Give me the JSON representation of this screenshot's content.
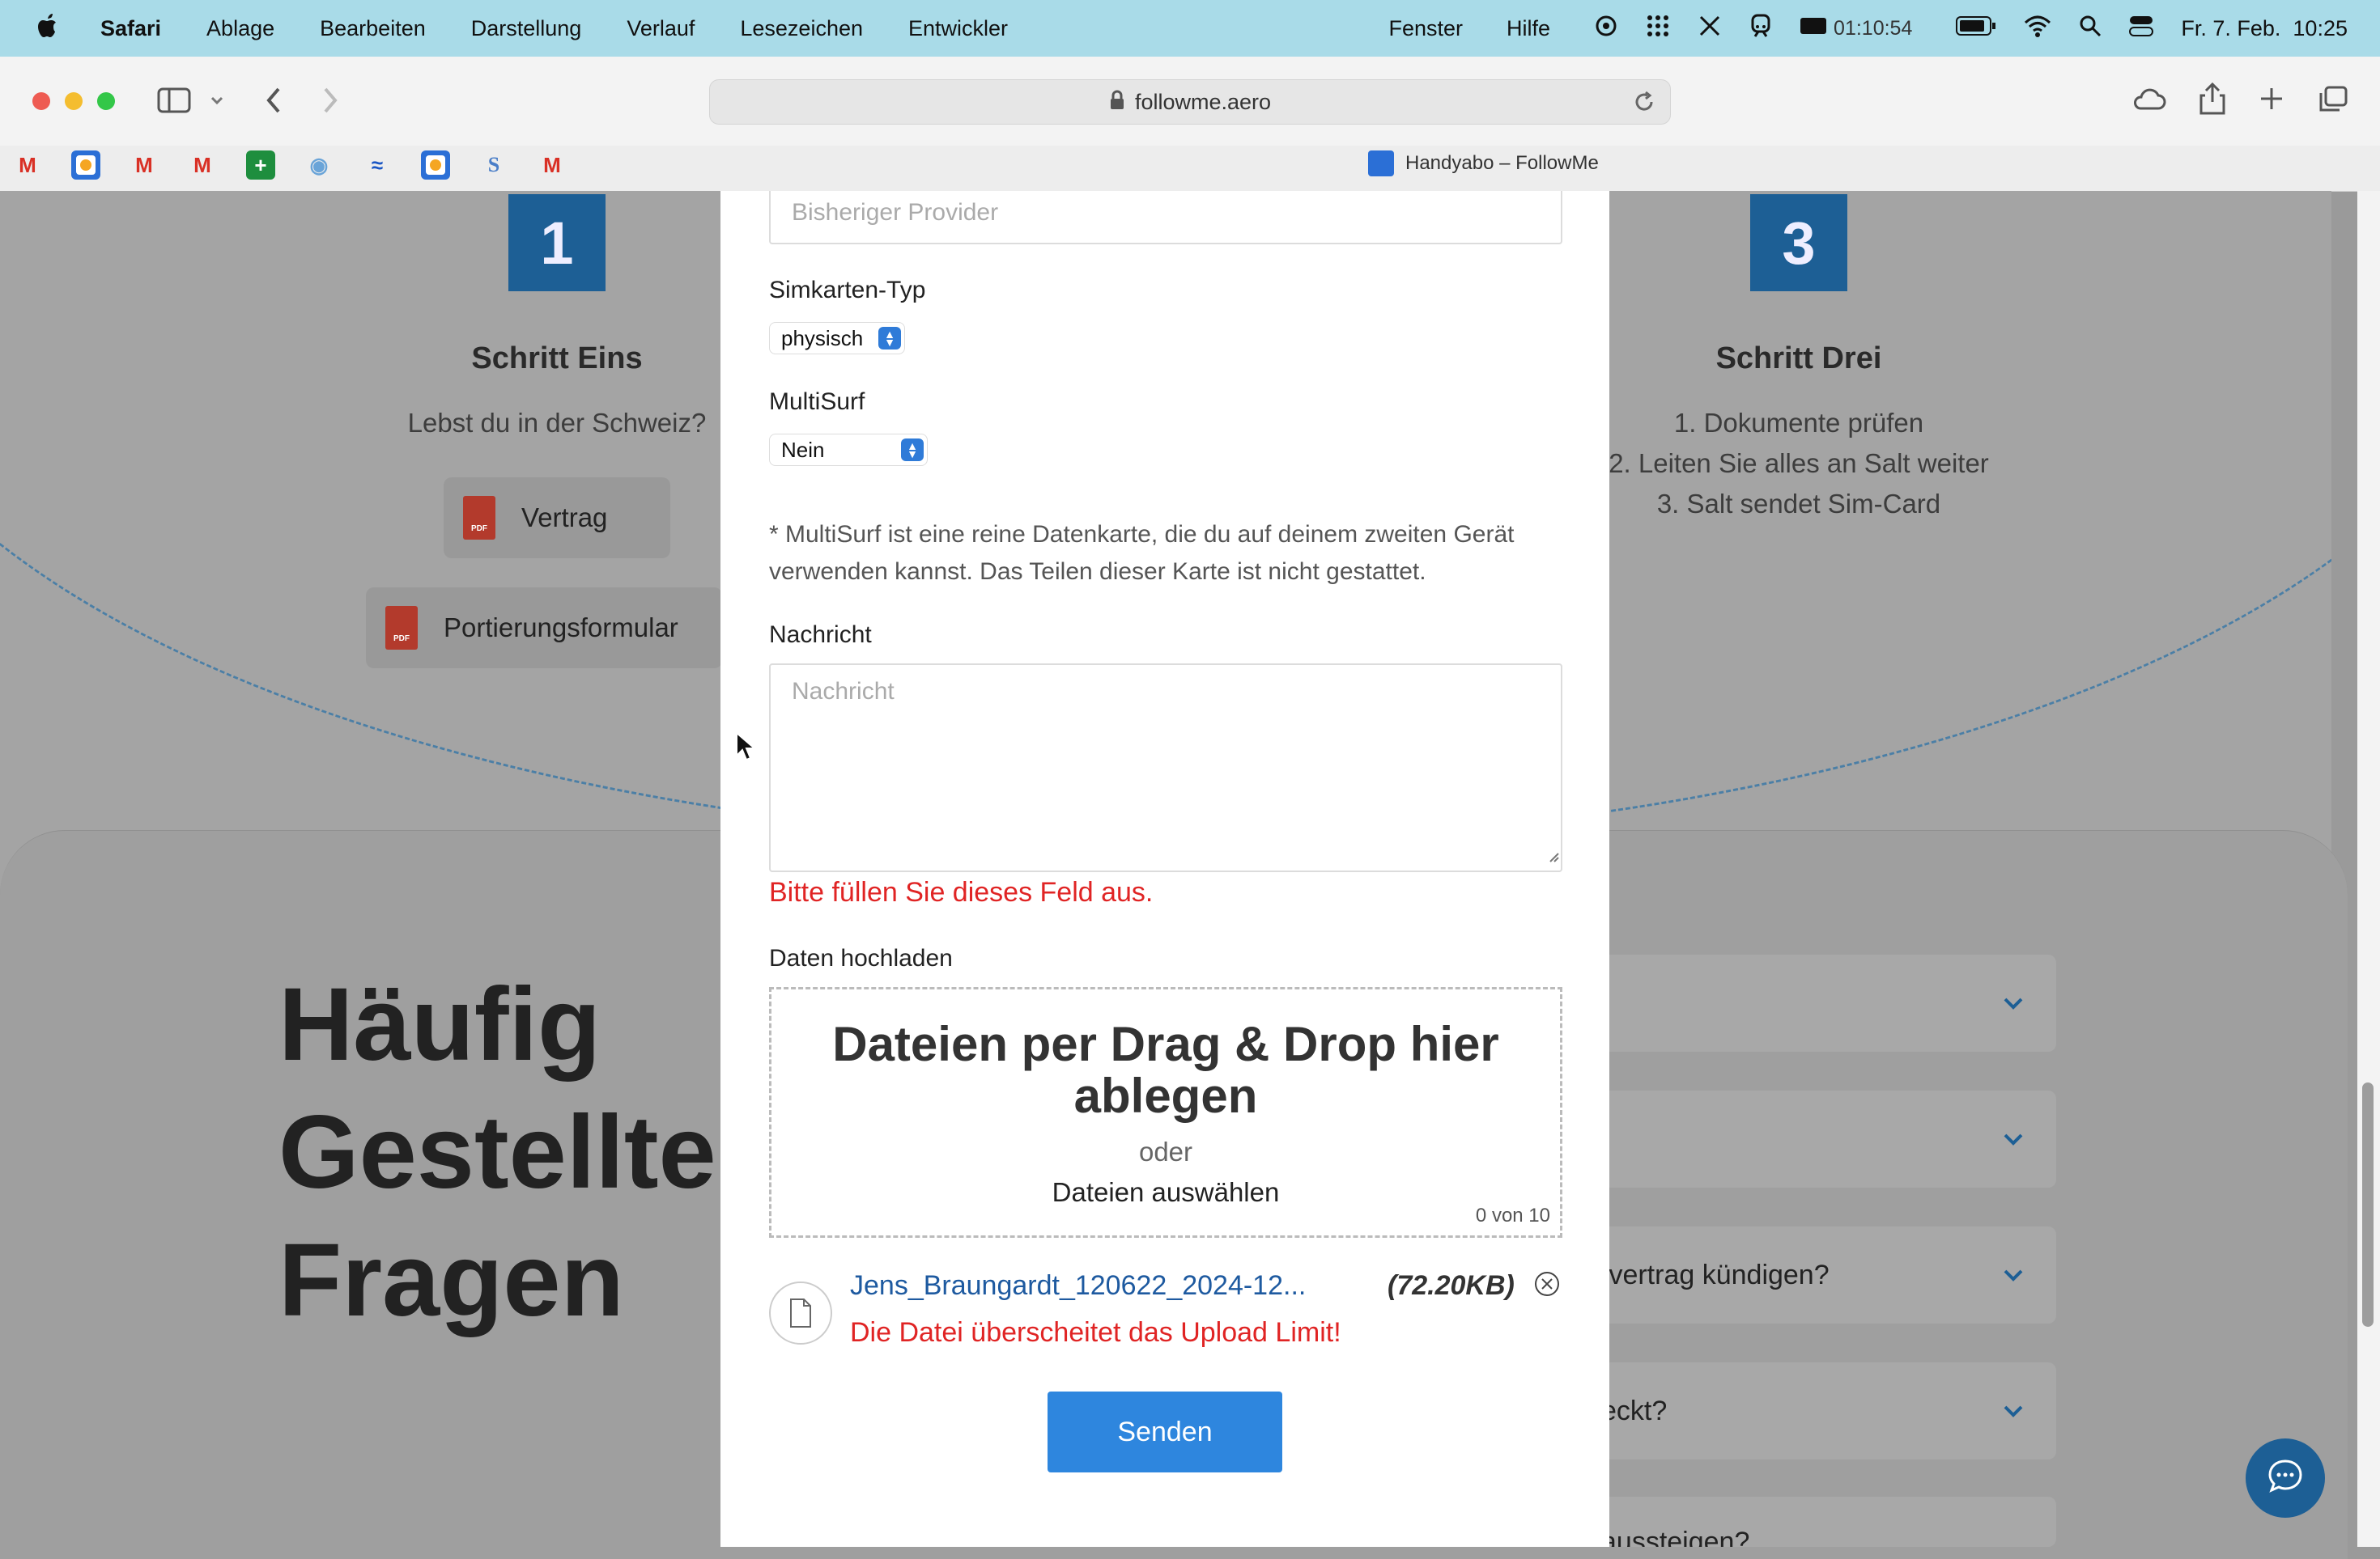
{
  "menubar": {
    "app": "Safari",
    "items": [
      "Ablage",
      "Bearbeiten",
      "Darstellung",
      "Verlauf",
      "Lesezeichen",
      "Entwickler"
    ],
    "right_items": [
      "Fenster",
      "Hilfe"
    ],
    "timer": "01:10:54",
    "datetime": "Fr. 7. Feb.  10:25"
  },
  "browser": {
    "url": "followme.aero",
    "tab_title": "Handyabo – FollowMe"
  },
  "steps": {
    "one": {
      "number": "1",
      "title": "Schritt Eins",
      "text": "Lebst du in der Schweiz?",
      "buttons": [
        "Vertrag",
        "Portierungsformular"
      ]
    },
    "three": {
      "number": "3",
      "title": "Schritt Drei",
      "lines": [
        "1. Dokumente prüfen",
        "2. Leiten Sie alles an Salt weiter",
        "3. Salt sendet Sim-Card"
      ]
    }
  },
  "faq": {
    "title_lines": [
      "Häufig",
      "Gestellte",
      "Fragen"
    ],
    "items": [
      "",
      "",
      "tvertrag kündigen?",
      "eckt?",
      "aussteigen?"
    ]
  },
  "form": {
    "provider_placeholder": "Bisheriger Provider",
    "simtype_label": "Simkarten-Typ",
    "simtype_value": "physisch",
    "multisurf_label": "MultiSurf",
    "multisurf_value": "Nein",
    "multisurf_note": "* MultiSurf ist eine reine Datenkarte, die du auf deinem zweiten Gerät verwenden kannst. Das Teilen dieser Karte ist nicht gestattet.",
    "message_label": "Nachricht",
    "message_placeholder": "Nachricht",
    "message_error": "Bitte füllen Sie dieses Feld aus.",
    "upload_label": "Daten hochladen",
    "drop_title": "Dateien per Drag & Drop hier ablegen",
    "drop_or": "oder",
    "drop_select": "Dateien auswählen",
    "file_count": "0 von 10",
    "file_name": "Jens_Braungardt_120622_2024-12...",
    "file_size": "(72.20KB)",
    "file_error": "Die Datei überscheitet das Upload Limit!",
    "submit_label": "Senden"
  },
  "colors": {
    "menubar": "#a9dbe8",
    "step_blue": "#1d5f95",
    "button_blue": "#2e86de",
    "error_red": "#e02424",
    "file_link": "#1e5aa0"
  }
}
